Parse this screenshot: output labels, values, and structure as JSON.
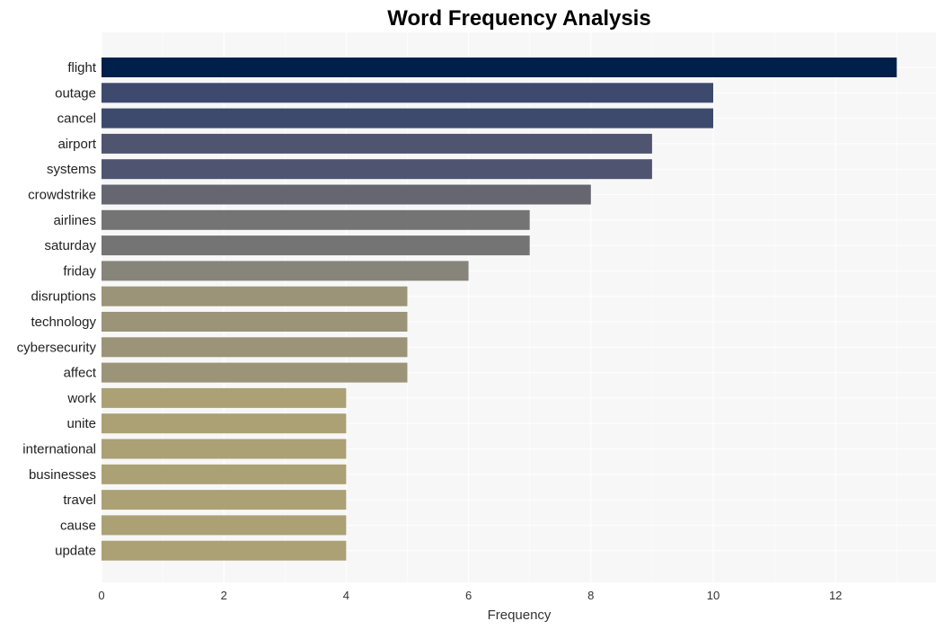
{
  "chart_data": {
    "type": "bar",
    "orientation": "horizontal",
    "title": "Word Frequency Analysis",
    "xlabel": "Frequency",
    "ylabel": "",
    "xlim": [
      0,
      13.6
    ],
    "xticks": [
      0,
      2,
      4,
      6,
      8,
      10,
      12
    ],
    "grid": true,
    "categories": [
      "flight",
      "outage",
      "cancel",
      "airport",
      "systems",
      "crowdstrike",
      "airlines",
      "saturday",
      "friday",
      "disruptions",
      "technology",
      "cybersecurity",
      "affect",
      "work",
      "unite",
      "international",
      "businesses",
      "travel",
      "cause",
      "update"
    ],
    "values": [
      13,
      10,
      10,
      9,
      9,
      8,
      7,
      7,
      6,
      5,
      5,
      5,
      5,
      4,
      4,
      4,
      4,
      4,
      4,
      4
    ],
    "colors": [
      "#00204c",
      "#3d4a6d",
      "#3d4a6d",
      "#4f5470",
      "#4f5470",
      "#656670",
      "#747474",
      "#747474",
      "#878479",
      "#9b9479",
      "#9b9479",
      "#9b9479",
      "#9b9479",
      "#aba175",
      "#aba175",
      "#aba175",
      "#aba175",
      "#aba175",
      "#aba175",
      "#aba175"
    ],
    "plot_background": "#f7f7f7"
  }
}
